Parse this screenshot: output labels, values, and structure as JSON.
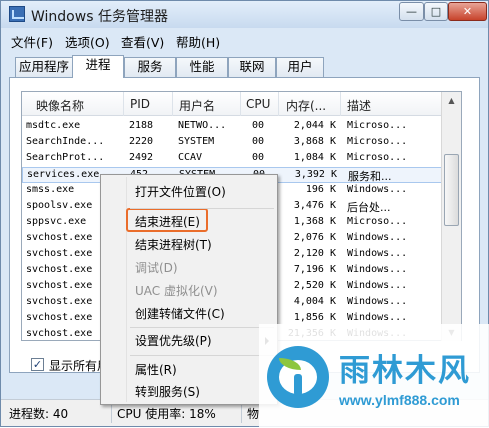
{
  "window": {
    "title": "Windows 任务管理器",
    "minimize": "—",
    "maximize": "□",
    "close": "✕"
  },
  "menubar": [
    "文件(F)",
    "选项(O)",
    "查看(V)",
    "帮助(H)"
  ],
  "tabs": [
    "应用程序",
    "进程",
    "服务",
    "性能",
    "联网",
    "用户"
  ],
  "active_tab": "进程",
  "columns": [
    "映像名称",
    "PID",
    "用户名",
    "CPU",
    "内存(...",
    "描述"
  ],
  "rows": [
    {
      "name": "msdtc.exe",
      "pid": "2188",
      "user": "NETWO...",
      "cpu": "00",
      "mem": "2,044 K",
      "desc": "Microso..."
    },
    {
      "name": "SearchInde...",
      "pid": "2220",
      "user": "SYSTEM",
      "cpu": "00",
      "mem": "3,868 K",
      "desc": "Microso..."
    },
    {
      "name": "SearchProt...",
      "pid": "2492",
      "user": "CCAV",
      "cpu": "00",
      "mem": "1,084 K",
      "desc": "Microso..."
    },
    {
      "name": "services.exe",
      "pid": "452",
      "user": "SYSTEM",
      "cpu": "00",
      "mem": "3,392 K",
      "desc": "服务和..."
    },
    {
      "name": "smss.exe",
      "pid": "",
      "user": "",
      "cpu": "",
      "mem": "196 K",
      "desc": "Windows..."
    },
    {
      "name": "spoolsv.exe",
      "pid": "",
      "user": "",
      "cpu": "",
      "mem": "3,476 K",
      "desc": "后台处..."
    },
    {
      "name": "sppsvc.exe",
      "pid": "",
      "user": "",
      "cpu": "",
      "mem": "1,368 K",
      "desc": "Microso..."
    },
    {
      "name": "svchost.exe",
      "pid": "",
      "user": "",
      "cpu": "",
      "mem": "2,076 K",
      "desc": "Windows..."
    },
    {
      "name": "svchost.exe",
      "pid": "",
      "user": "",
      "cpu": "",
      "mem": "2,120 K",
      "desc": "Windows..."
    },
    {
      "name": "svchost.exe",
      "pid": "",
      "user": "",
      "cpu": "",
      "mem": "7,196 K",
      "desc": "Windows..."
    },
    {
      "name": "svchost.exe",
      "pid": "",
      "user": "",
      "cpu": "",
      "mem": "2,520 K",
      "desc": "Windows..."
    },
    {
      "name": "svchost.exe",
      "pid": "",
      "user": "",
      "cpu": "",
      "mem": "4,004 K",
      "desc": "Windows..."
    },
    {
      "name": "svchost.exe",
      "pid": "",
      "user": "",
      "cpu": "",
      "mem": "1,856 K",
      "desc": "Windows..."
    },
    {
      "name": "svchost.exe",
      "pid": "",
      "user": "",
      "cpu": "",
      "mem": "21,356 K",
      "desc": "Windows..."
    }
  ],
  "selected_row": 3,
  "show_all_label": "显示所有用",
  "show_all_checked": "✓",
  "status": {
    "processes": "进程数: 40",
    "cpu": "CPU 使用率: 18%",
    "memory": "物"
  },
  "context_menu": {
    "items": [
      {
        "label": "打开文件位置(O)",
        "disabled": false
      },
      {
        "label": "结束进程(E)",
        "disabled": false,
        "highlighted": true
      },
      {
        "label": "结束进程树(T)",
        "disabled": false
      },
      {
        "label": "调试(D)",
        "disabled": true
      },
      {
        "label": "UAC 虚拟化(V)",
        "disabled": true
      },
      {
        "label": "创建转储文件(C)",
        "disabled": false
      },
      {
        "label": "设置优先级(P)",
        "disabled": false,
        "submenu": true
      },
      {
        "label": "属性(R)",
        "disabled": false
      },
      {
        "label": "转到服务(S)",
        "disabled": false
      }
    ],
    "highlight_color": "#ea6d2b"
  },
  "watermark": {
    "title": "雨林木风",
    "url": "www.ylmf888.com",
    "color": "#2f9bd4"
  }
}
